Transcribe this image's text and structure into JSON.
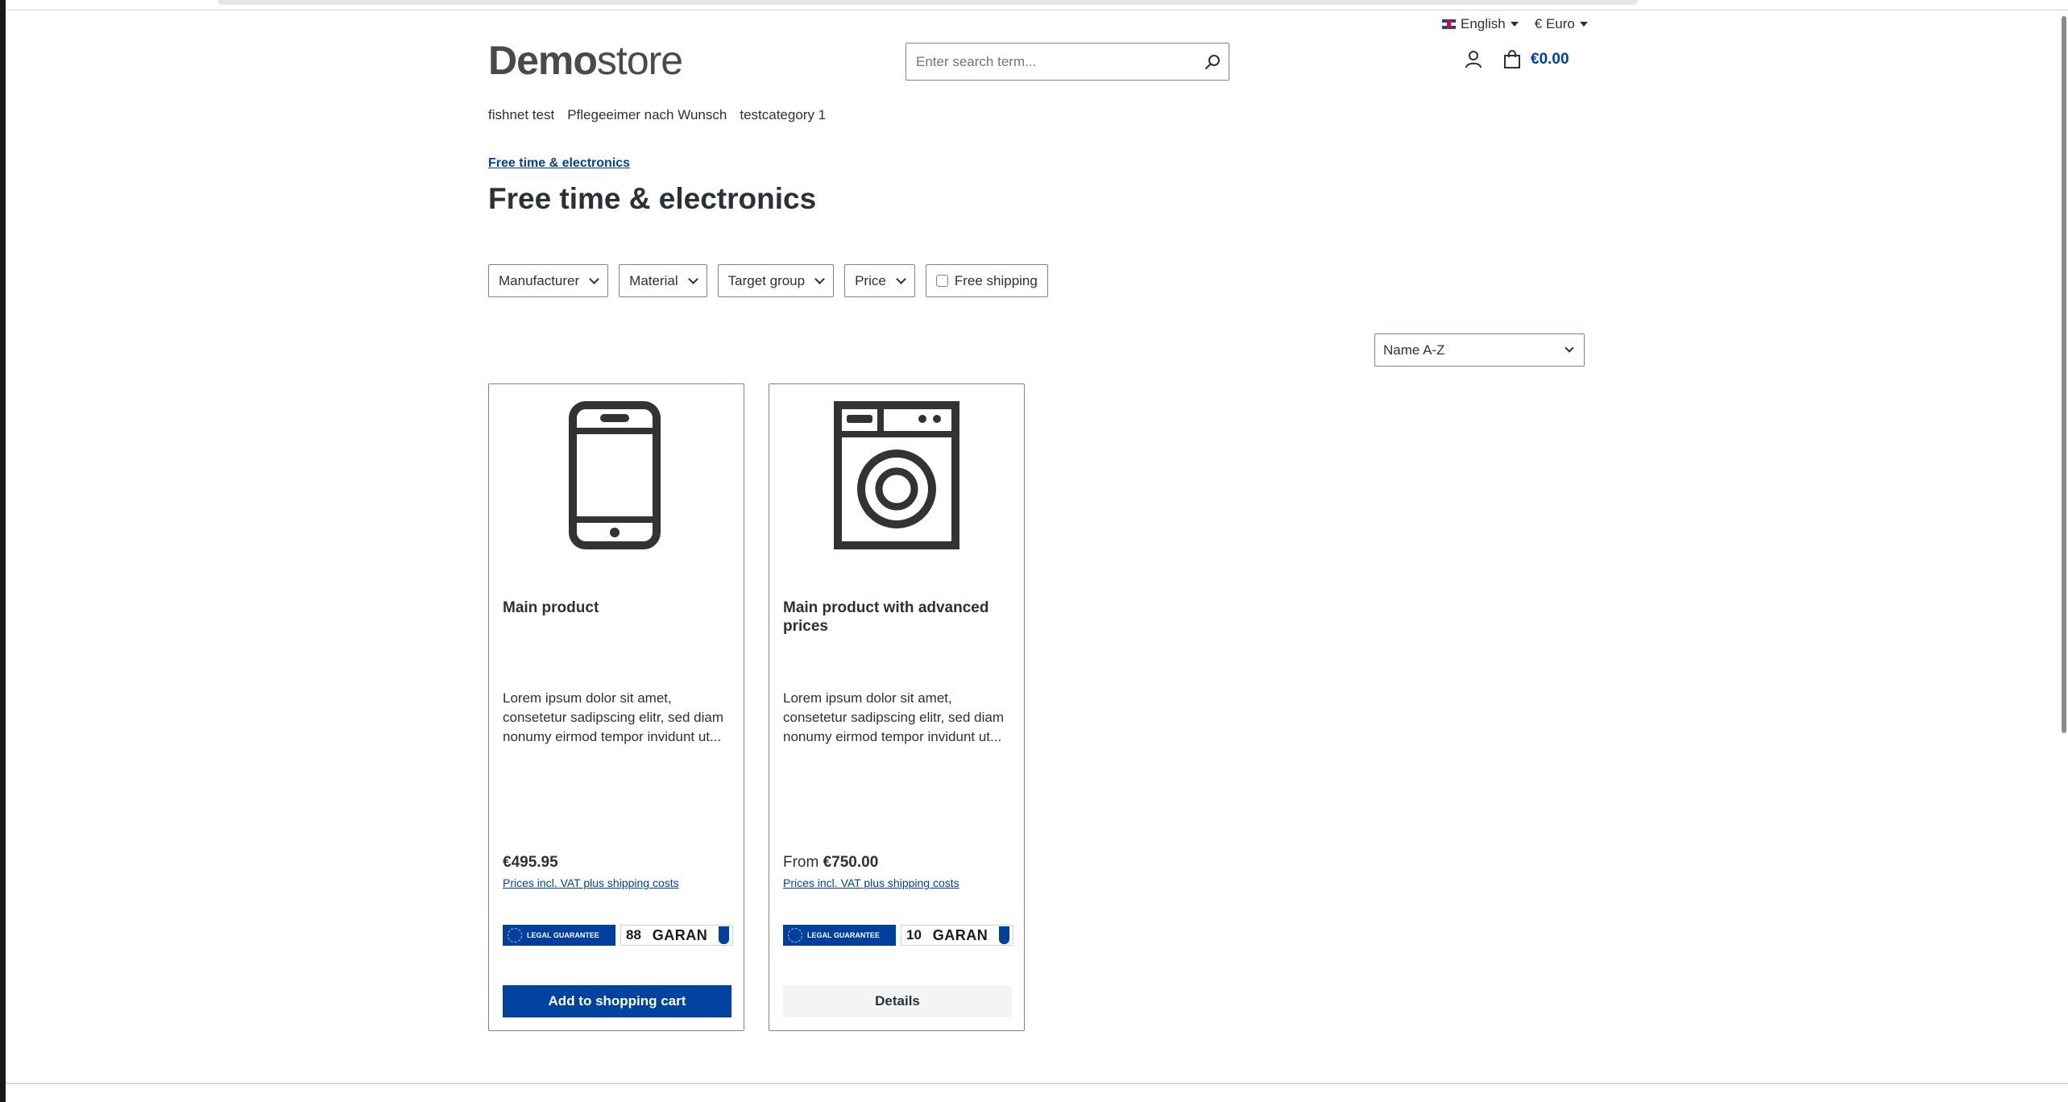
{
  "topbar": {
    "language": "English",
    "currency": "€ Euro"
  },
  "header": {
    "logo_bold": "Demo",
    "logo_light": "store",
    "search_placeholder": "Enter search term...",
    "cart_total": "€0.00"
  },
  "nav": {
    "items": [
      "fishnet test",
      "Pflegeeimer nach Wunsch",
      "testcategory 1"
    ]
  },
  "breadcrumb": "Free time & electronics",
  "page_title": "Free time & electronics",
  "filters": {
    "manufacturer": "Manufacturer",
    "material": "Material",
    "target_group": "Target group",
    "price": "Price",
    "free_shipping": "Free shipping"
  },
  "sort": {
    "selected": "Name A-Z"
  },
  "products": [
    {
      "name": "Main product",
      "description": "Lorem ipsum dolor sit amet, consetetur sadipscing elitr, sed diam nonumy eirmod tempor invidunt ut...",
      "price_prefix": "",
      "price": "€495.95",
      "vat_note": "Prices incl. VAT plus shipping costs",
      "badge_legal": "LEGAL GUARANTEE",
      "badge_number": "88",
      "badge_text": "GARAN",
      "button": "Add to shopping cart",
      "icon": "smartphone-icon"
    },
    {
      "name": "Main product with advanced prices",
      "description": "Lorem ipsum dolor sit amet, consetetur sadipscing elitr, sed diam nonumy eirmod tempor invidunt ut...",
      "price_prefix": "From",
      "price": "€750.00",
      "vat_note": "Prices incl. VAT plus shipping costs",
      "badge_legal": "LEGAL GUARANTEE",
      "badge_number": "10",
      "badge_text": "GARAN",
      "button": "Details",
      "icon": "washing-machine-icon"
    }
  ],
  "colors": {
    "accent": "#0042a0",
    "text": "#2b3136",
    "border": "#798490"
  }
}
